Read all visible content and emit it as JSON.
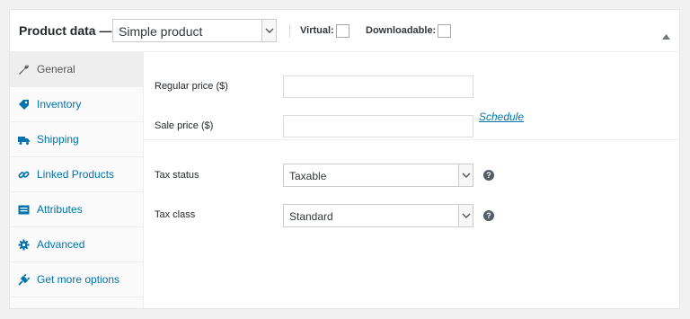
{
  "header": {
    "title": "Product data —",
    "product_type": "Simple product",
    "virtual_label": "Virtual:",
    "virtual_checked": false,
    "downloadable_label": "Downloadable:",
    "downloadable_checked": false,
    "collapse_icon": "triangle-up-icon"
  },
  "sidebar": {
    "items": [
      {
        "label": "General",
        "icon": "wrench-icon",
        "active": true
      },
      {
        "label": "Inventory",
        "icon": "tag-icon",
        "active": false
      },
      {
        "label": "Shipping",
        "icon": "truck-icon",
        "active": false
      },
      {
        "label": "Linked Products",
        "icon": "link-icon",
        "active": false
      },
      {
        "label": "Attributes",
        "icon": "list-icon",
        "active": false
      },
      {
        "label": "Advanced",
        "icon": "gear-icon",
        "active": false
      },
      {
        "label": "Get more options",
        "icon": "plugin-icon",
        "active": false
      }
    ]
  },
  "general": {
    "regular_price_label": "Regular price ($)",
    "regular_price_value": "",
    "sale_price_label": "Sale price ($)",
    "sale_price_value": "",
    "schedule_link": "Schedule",
    "tax_status_label": "Tax status",
    "tax_status_value": "Taxable",
    "tax_class_label": "Tax class",
    "tax_class_value": "Standard"
  },
  "colors": {
    "link": "#0073aa",
    "active_tab_bg": "#eeeeee",
    "sidebar_bg": "#fafafa"
  }
}
